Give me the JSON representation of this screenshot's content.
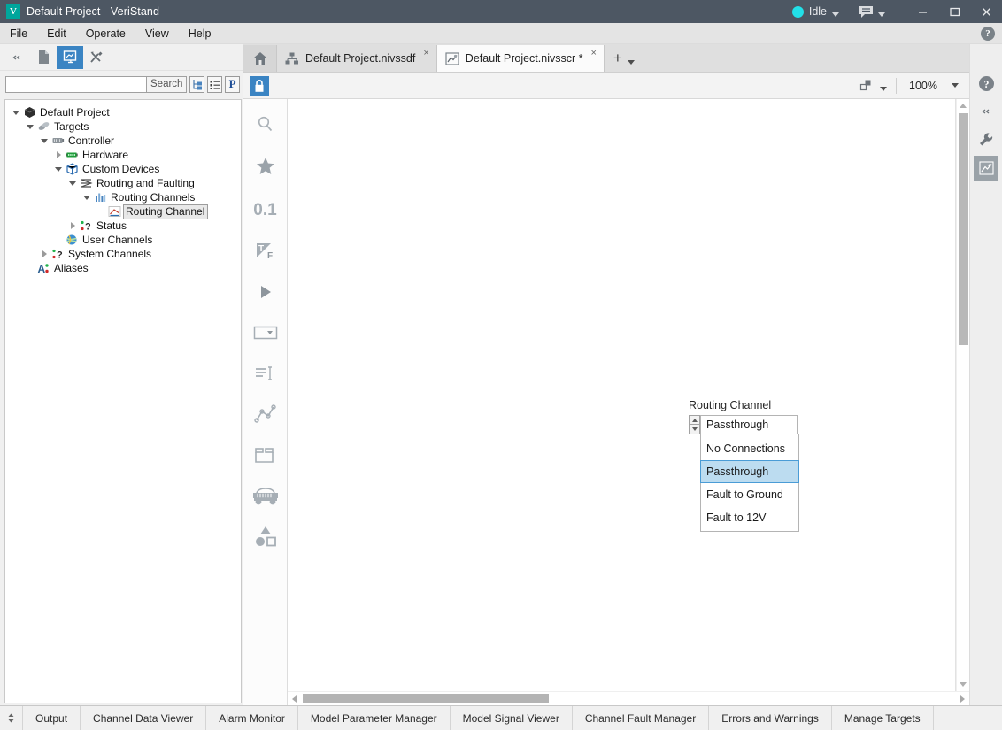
{
  "window": {
    "title": "Default Project - VeriStand",
    "app_icon": "V",
    "status_label": "Idle",
    "status_color": "#22e0e8",
    "minimize_icon": "minimize-icon",
    "maximize_icon": "maximize-icon",
    "close_icon": "close-icon",
    "chat_icon": "chat-bubble-icon",
    "help_icon": "help-icon"
  },
  "menu": {
    "items": [
      {
        "label": "File"
      },
      {
        "label": "Edit"
      },
      {
        "label": "Operate"
      },
      {
        "label": "View"
      },
      {
        "label": "Help"
      }
    ]
  },
  "left_toolbar": {
    "collapse_label": "◂◂",
    "buttons": [
      {
        "name": "collapse-panel-button",
        "icon": "double-chevron-left-icon"
      },
      {
        "name": "new-document-button",
        "icon": "document-icon"
      },
      {
        "name": "screen-button",
        "icon": "screen-monitor-icon",
        "active": true
      },
      {
        "name": "tools-button",
        "icon": "hammer-wrench-icon"
      }
    ]
  },
  "search": {
    "value": "",
    "placeholder": "",
    "button_label": "Search",
    "icons": [
      {
        "name": "tree-view-icon"
      },
      {
        "name": "list-view-icon"
      },
      {
        "name": "properties-icon",
        "glyph": "P"
      }
    ]
  },
  "tree": {
    "nodes": [
      {
        "label": "Default Project",
        "indent": 0,
        "twisty": "expanded",
        "icon": "cube-icon",
        "selected": false
      },
      {
        "label": "Targets",
        "indent": 1,
        "twisty": "expanded",
        "icon": "targets-icon",
        "selected": false
      },
      {
        "label": "Controller",
        "indent": 2,
        "twisty": "expanded",
        "icon": "controller-icon",
        "selected": false
      },
      {
        "label": "Hardware",
        "indent": 3,
        "twisty": "collapsed",
        "icon": "hardware-chip-icon",
        "selected": false
      },
      {
        "label": "Custom Devices",
        "indent": 3,
        "twisty": "expanded",
        "icon": "custom-device-icon",
        "selected": false
      },
      {
        "label": "Routing and Faulting",
        "indent": 4,
        "twisty": "expanded",
        "icon": "routing-faulting-icon",
        "selected": false
      },
      {
        "label": "Routing Channels",
        "indent": 5,
        "twisty": "expanded",
        "icon": "routing-channels-icon",
        "selected": false
      },
      {
        "label": "Routing Channel",
        "indent": 6,
        "twisty": "none",
        "icon": "routing-channel-icon",
        "selected": true
      },
      {
        "label": "Status",
        "indent": 4,
        "twisty": "collapsed",
        "icon": "status-channels-icon",
        "selected": false
      },
      {
        "label": "User Channels",
        "indent": 3,
        "twisty": "none",
        "icon": "user-channels-icon",
        "selected": false
      },
      {
        "label": "System Channels",
        "indent": 2,
        "twisty": "collapsed",
        "icon": "system-channels-icon",
        "selected": false
      },
      {
        "label": "Aliases",
        "indent": 1,
        "twisty": "none",
        "icon": "aliases-icon",
        "selected": false
      }
    ]
  },
  "tabs": {
    "home_icon": "home-icon",
    "items": [
      {
        "label": "Default Project.nivssdf",
        "icon": "system-definition-icon",
        "active": false,
        "close": "×"
      },
      {
        "label": "Default Project.nivsscr *",
        "icon": "screen-document-icon",
        "active": true,
        "close": "×"
      }
    ],
    "add_label": "+",
    "add_icon": "plus-icon"
  },
  "editor_toolbar": {
    "lock_icon": "lock-icon",
    "layers_icon": "layers-icon",
    "zoom_value": "100%",
    "zoom_caret": "chevron-down-icon"
  },
  "palette": {
    "groups": [
      {
        "items": [
          {
            "name": "search-palette-icon",
            "icon": "magnifier-icon"
          },
          {
            "name": "favorites-palette-icon",
            "icon": "star-icon"
          }
        ]
      },
      {
        "items": [
          {
            "name": "numeric-palette-icon",
            "icon": "numeric-icon",
            "text": "0.1"
          },
          {
            "name": "boolean-palette-icon",
            "icon": "true-false-icon"
          },
          {
            "name": "button-palette-icon",
            "icon": "play-triangle-icon"
          },
          {
            "name": "dropdown-palette-icon",
            "icon": "combo-box-icon"
          },
          {
            "name": "text-palette-icon",
            "icon": "text-lines-icon"
          },
          {
            "name": "graph-palette-icon",
            "icon": "line-graph-icon"
          },
          {
            "name": "container-palette-icon",
            "icon": "folder-tab-icon"
          },
          {
            "name": "vehicle-palette-icon",
            "icon": "jeep-icon"
          },
          {
            "name": "shapes-palette-icon",
            "icon": "shapes-icon"
          }
        ]
      }
    ]
  },
  "canvas": {
    "control": {
      "label": "Routing Channel",
      "value": "Passthrough",
      "spinner_up": "spinner-increment",
      "spinner_down": "spinner-decrement",
      "options": [
        {
          "label": "No Connections",
          "selected": false
        },
        {
          "label": "Passthrough",
          "selected": true
        },
        {
          "label": "Fault to Ground",
          "selected": false
        },
        {
          "label": "Fault to 12V",
          "selected": false
        }
      ]
    },
    "selection_color": "#bcdcf0",
    "selection_border": "#4a9cd6"
  },
  "edge_toolbar": {
    "buttons": [
      {
        "name": "help-edge-icon",
        "icon": "help-circle-icon"
      },
      {
        "name": "collapse-edge-icon",
        "icon": "double-chevron-left-icon"
      },
      {
        "name": "wrench-edge-icon",
        "icon": "wrench-icon"
      },
      {
        "name": "screen-edge-icon",
        "icon": "screen-document-icon",
        "selected": true
      }
    ]
  },
  "status_tabs": {
    "expander_icon": "expand-collapse-icon",
    "items": [
      {
        "label": "Output"
      },
      {
        "label": "Channel Data Viewer"
      },
      {
        "label": "Alarm Monitor"
      },
      {
        "label": "Model Parameter Manager"
      },
      {
        "label": "Model Signal Viewer"
      },
      {
        "label": "Channel Fault Manager"
      },
      {
        "label": "Errors and Warnings"
      },
      {
        "label": "Manage Targets"
      }
    ]
  }
}
